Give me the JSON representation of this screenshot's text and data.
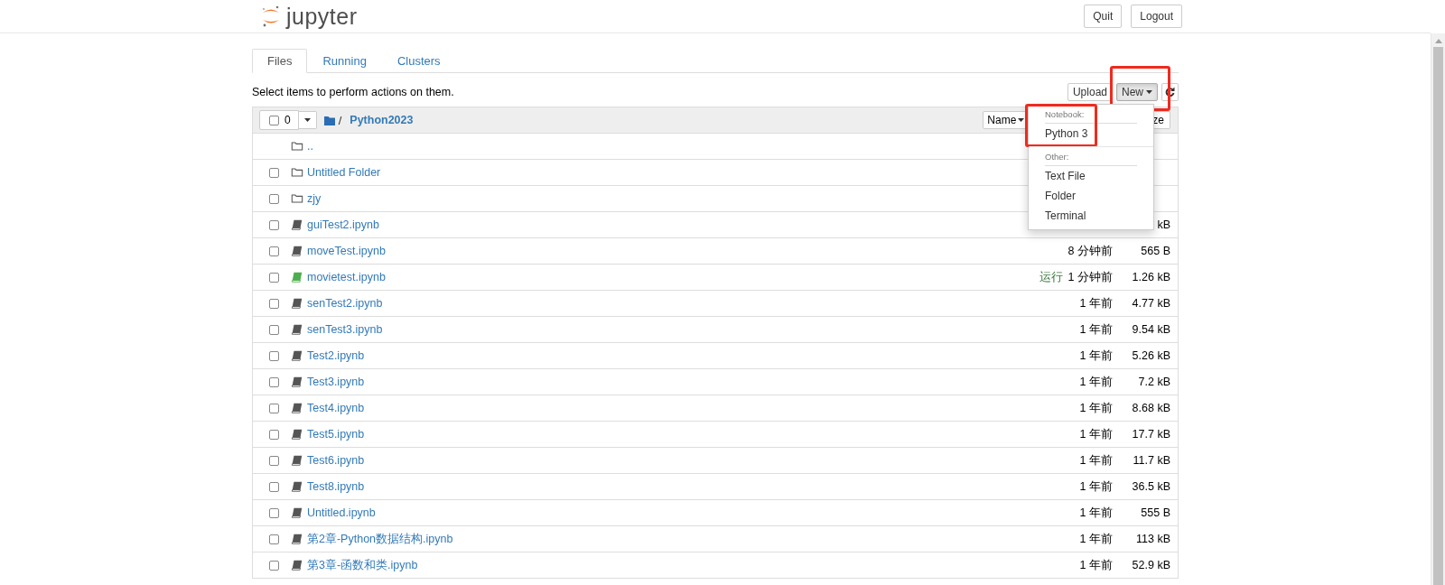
{
  "header": {
    "logo_text": "jupyter",
    "buttons": [
      "Quit",
      "Logout"
    ]
  },
  "tabs": [
    {
      "label": "Files",
      "selected": true
    },
    {
      "label": "Running",
      "selected": false
    },
    {
      "label": "Clusters",
      "selected": false
    }
  ],
  "toolbar": {
    "hint": "Select items to perform actions on them.",
    "buttons": [
      "Upload",
      "New"
    ]
  },
  "new_menu": {
    "sections": [
      {
        "heading": "Notebook:",
        "items": [
          "Python 3"
        ]
      },
      {
        "heading": "Other:",
        "items": [
          "Text File",
          "Folder",
          "Terminal"
        ]
      }
    ]
  },
  "listing_header": {
    "selected_count": "0",
    "select_all_checked": false,
    "path_separator": "/",
    "path": "Python2023",
    "sort_buttons": [
      "Name",
      "ze"
    ]
  },
  "rows": [
    {
      "kind": "parent",
      "name": ".."
    },
    {
      "kind": "folder",
      "name": "Untitled Folder",
      "checked": false
    },
    {
      "kind": "folder",
      "name": "zjy",
      "checked": false
    },
    {
      "kind": "notebook",
      "name": "guiTest2.ipynb",
      "checked": false,
      "running": false,
      "size": "kB"
    },
    {
      "kind": "notebook",
      "name": "moveTest.ipynb",
      "checked": false,
      "running": false,
      "modified": "8 分钟前",
      "size": "565 B"
    },
    {
      "kind": "notebook",
      "name": "movietest.ipynb",
      "checked": false,
      "running": true,
      "status": "运行",
      "modified": "1 分钟前",
      "size": "1.26 kB"
    },
    {
      "kind": "notebook",
      "name": "senTest2.ipynb",
      "checked": false,
      "running": false,
      "modified": "1 年前",
      "size": "4.77 kB"
    },
    {
      "kind": "notebook",
      "name": "senTest3.ipynb",
      "checked": false,
      "running": false,
      "modified": "1 年前",
      "size": "9.54 kB"
    },
    {
      "kind": "notebook",
      "name": "Test2.ipynb",
      "checked": false,
      "running": false,
      "modified": "1 年前",
      "size": "5.26 kB"
    },
    {
      "kind": "notebook",
      "name": "Test3.ipynb",
      "checked": false,
      "running": false,
      "modified": "1 年前",
      "size": "7.2 kB"
    },
    {
      "kind": "notebook",
      "name": "Test4.ipynb",
      "checked": false,
      "running": false,
      "modified": "1 年前",
      "size": "8.68 kB"
    },
    {
      "kind": "notebook",
      "name": "Test5.ipynb",
      "checked": false,
      "running": false,
      "modified": "1 年前",
      "size": "17.7 kB"
    },
    {
      "kind": "notebook",
      "name": "Test6.ipynb",
      "checked": false,
      "running": false,
      "modified": "1 年前",
      "size": "11.7 kB"
    },
    {
      "kind": "notebook",
      "name": "Test8.ipynb",
      "checked": false,
      "running": false,
      "modified": "1 年前",
      "size": "36.5 kB"
    },
    {
      "kind": "notebook",
      "name": "Untitled.ipynb",
      "checked": false,
      "running": false,
      "modified": "1 年前",
      "size": "555 B"
    },
    {
      "kind": "notebook",
      "name": "第2章-Python数据结构.ipynb",
      "checked": false,
      "running": false,
      "modified": "1 年前",
      "size": "113 kB"
    },
    {
      "kind": "notebook",
      "name": "第3章-函数和类.ipynb",
      "checked": false,
      "running": false,
      "modified": "1 年前",
      "size": "52.9 kB"
    }
  ]
}
